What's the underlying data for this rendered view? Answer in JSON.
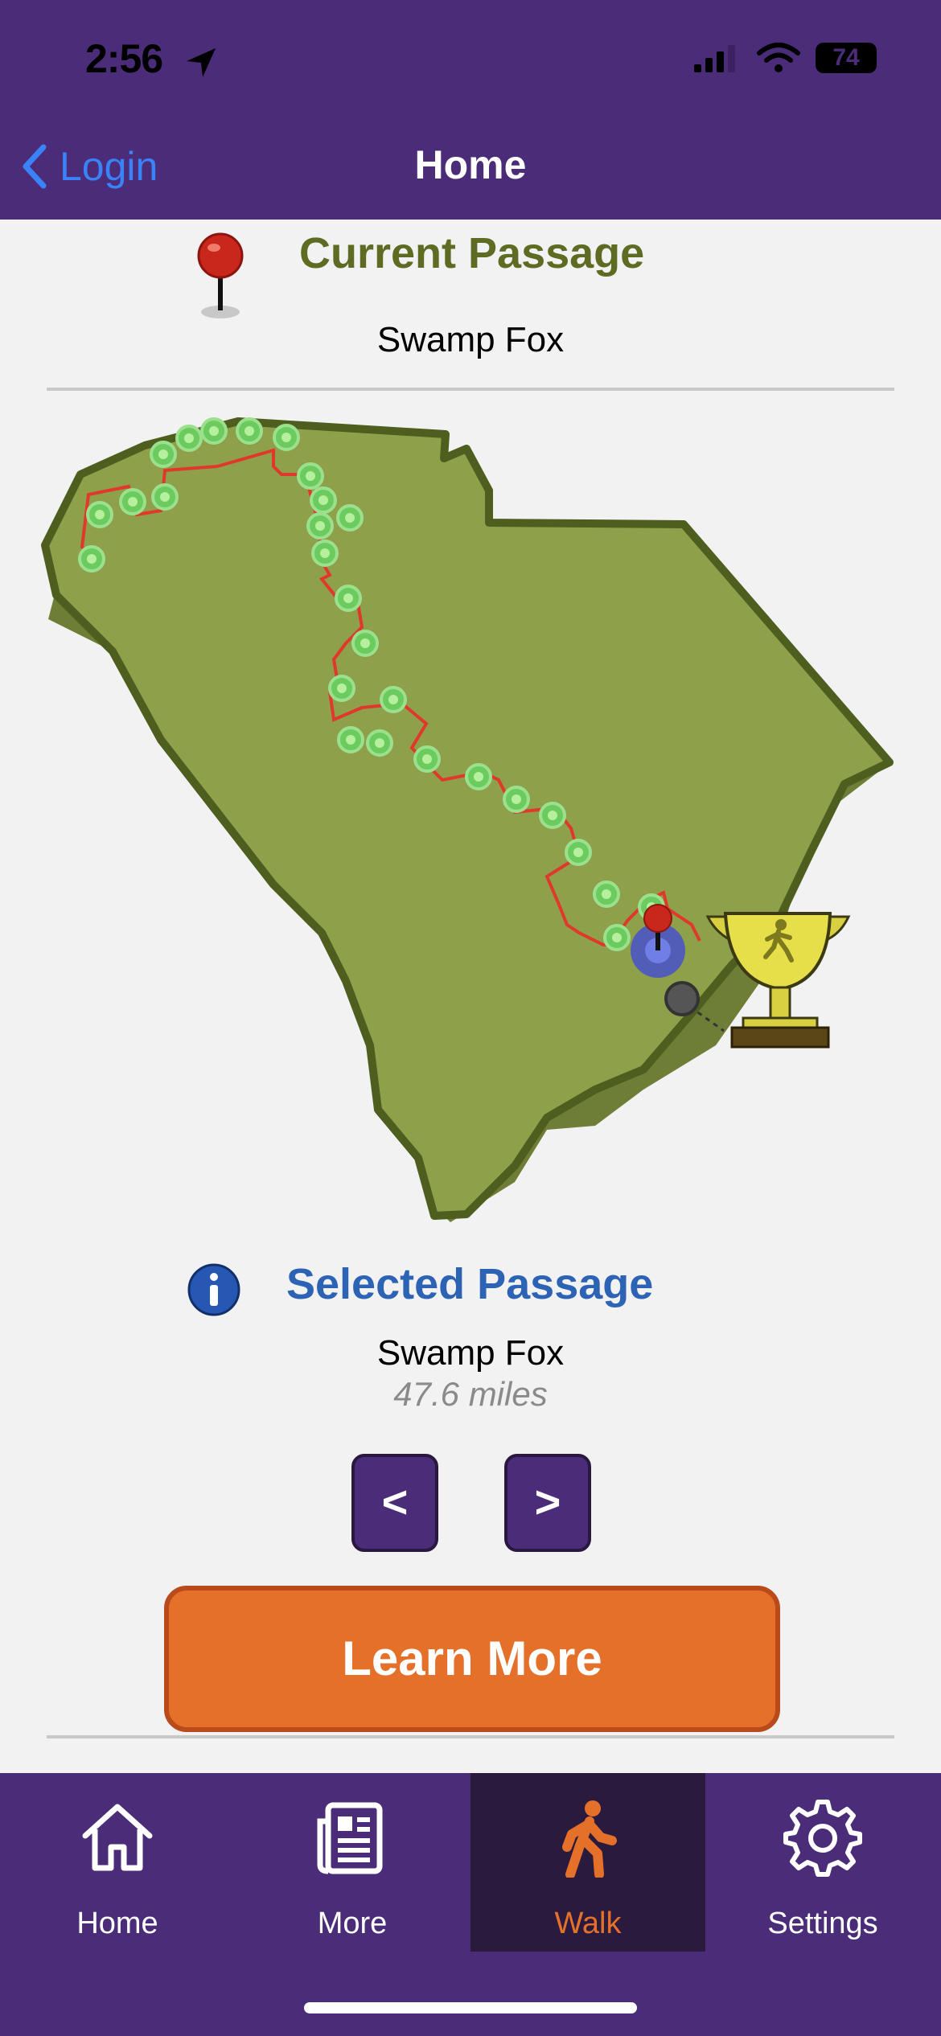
{
  "status": {
    "time": "2:56",
    "battery": "74"
  },
  "nav": {
    "back_label": "Login",
    "title": "Home"
  },
  "current": {
    "title": "Current Passage",
    "name": "Swamp Fox"
  },
  "selected": {
    "title": "Selected Passage",
    "name": "Swamp Fox",
    "distance": "47.6 miles"
  },
  "buttons": {
    "prev": "<",
    "next": ">",
    "learn_more": "Learn More"
  },
  "tabs": [
    {
      "label": "Home",
      "icon": "house-icon"
    },
    {
      "label": "More",
      "icon": "newspaper-icon"
    },
    {
      "label": "Walk",
      "icon": "walking-person-icon",
      "active": true
    },
    {
      "label": "Settings",
      "icon": "gear-icon"
    }
  ],
  "colors": {
    "header": "#4b2c78",
    "map_fill": "#8fa04b",
    "map_outline": "#4d5e1f",
    "passage_dot": "#6ccb5f",
    "trail": "#e0392b",
    "accent_orange": "#e5702a",
    "selected_blue": "#2d63b5"
  }
}
